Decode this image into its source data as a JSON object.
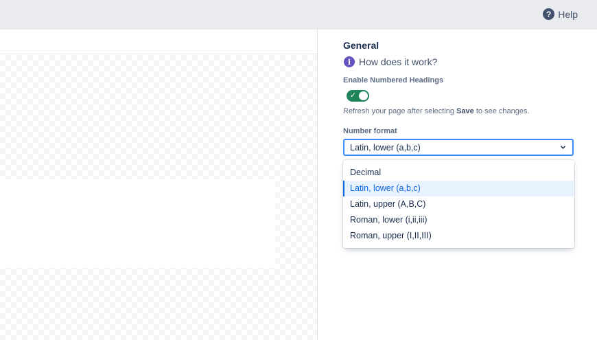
{
  "header": {
    "help_icon": "?",
    "help_label": "Help"
  },
  "panel": {
    "section_title": "General",
    "info_icon": "i",
    "how_it_works": "How does it work?",
    "enable_label": "Enable Numbered Headings",
    "toggle_on": true,
    "toggle_check": "✓",
    "hint_prefix": "Refresh your page after selecting ",
    "hint_bold": "Save",
    "hint_suffix": " to see changes.",
    "format_label": "Number format",
    "selected_format": "Latin, lower (a,b,c)",
    "options": [
      "Decimal",
      "Latin, lower (a,b,c)",
      "Latin, upper (A,B,C)",
      "Roman, lower (i,ii,iii)",
      "Roman, upper (I,II,III)"
    ]
  },
  "colors": {
    "toggle_on": "#1F845A",
    "focus_border": "#388BFF",
    "selected_bg": "#E9F2FF",
    "selected_text": "#0C66E4",
    "info": "#6554C0"
  },
  "icons": {
    "help": "question-circle-icon",
    "info": "info-circle-icon",
    "dropdown": "chevron-down-icon",
    "toggle": "check-icon"
  }
}
